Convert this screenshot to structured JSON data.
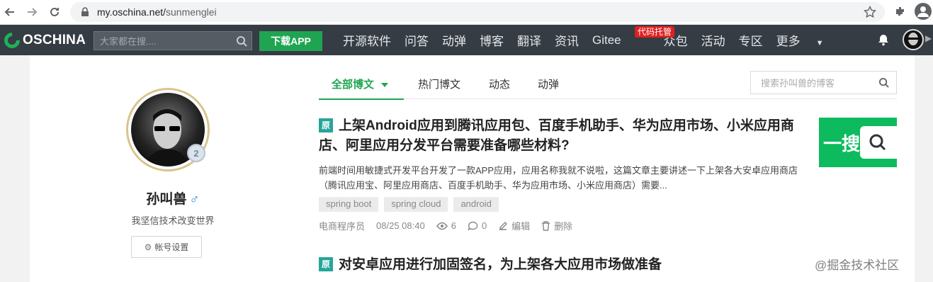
{
  "browser": {
    "url_host": "my.oschina.net/",
    "url_path": "sunmenglei"
  },
  "header": {
    "logo_text": "OSCHINA",
    "search_placeholder": "大家都在搜....",
    "download_label": "下载APP",
    "menu": [
      "开源软件",
      "问答",
      "动弹",
      "博客",
      "翻译",
      "资讯",
      "Gitee",
      "众包",
      "活动",
      "专区",
      "更多"
    ],
    "gitee_badge": "代码托管"
  },
  "profile": {
    "name": "孙叫兽",
    "gender_symbol": "♂",
    "level": "2",
    "motto": "我坚信技术改变世界",
    "account_settings": "帐号设置"
  },
  "tabs": {
    "items": [
      "全部博文",
      "热门博文",
      "动态",
      "动弹"
    ],
    "active": "全部博文",
    "search_placeholder": "搜索孙叫兽的博客"
  },
  "articles": [
    {
      "badge": "原",
      "title": "上架Android应用到腾讯应用包、百度手机助手、华为应用市场、小米应用商店、阿里应用分发平台需要准备哪些材料?",
      "summary": "前端时间用敏捷式开发平台开发了一款APP应用，应用名称我就不说啦，这篇文章主要讲述一下上架各大安卓应用商店（腾讯应用宝、阿里应用商店、百度手机助手、华为应用市场、小米应用商店）需要...",
      "tags": [
        "spring boot",
        "spring cloud",
        "android"
      ],
      "category": "电商程序员",
      "time": "08/25 08:40",
      "views": "6",
      "comments": "0",
      "edit_label": "编辑",
      "delete_label": "删除",
      "thumb_text": "一搜"
    },
    {
      "badge": "原",
      "title": "对安卓应用进行加固签名，为上架各大应用市场做准备"
    }
  ],
  "watermark": "@掘金技术社区",
  "colors": {
    "accent": "#1fa551",
    "header_bg": "#353c44",
    "badge": "#26a59a"
  }
}
